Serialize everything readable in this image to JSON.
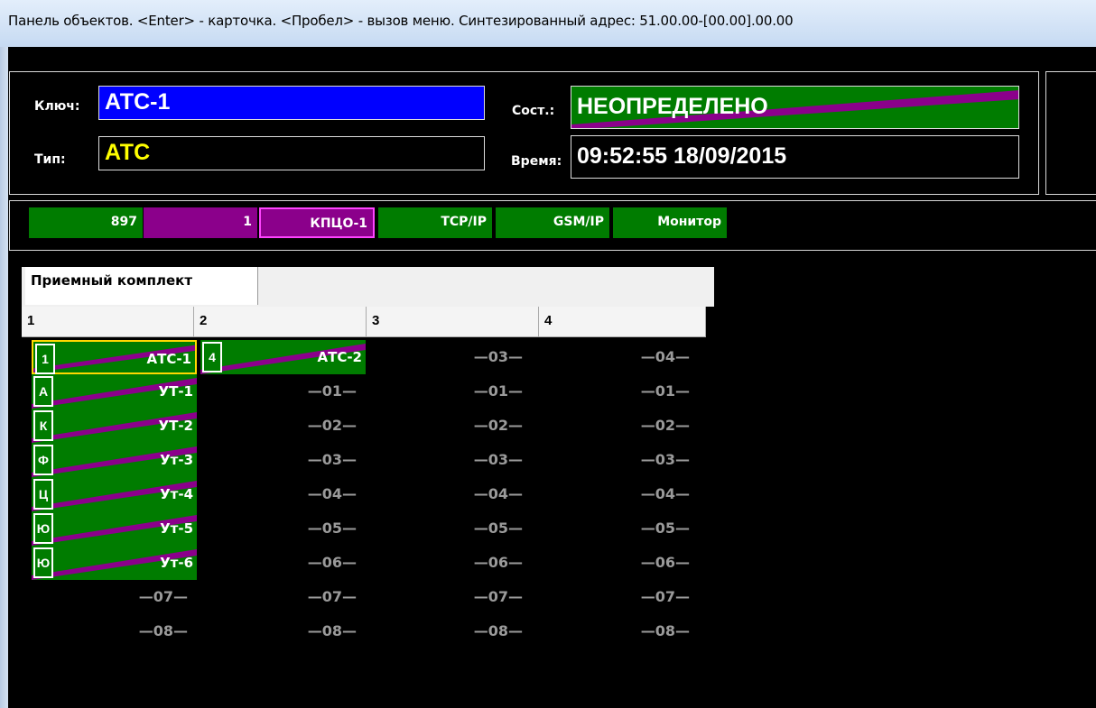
{
  "window": {
    "title": "Панель объектов. <Enter> - карточка. <Пробел> - вызов меню. Синтезированный адрес: 51.00.00-[00.00].00.00"
  },
  "header": {
    "key_label": "Ключ:",
    "key_value": "АТС-1",
    "type_label": "Тип:",
    "type_value": "АТС",
    "state_label": "Сост.:",
    "state_value": "НЕОПРЕДЕЛЕНО",
    "time_label": "Время:",
    "time_value": "09:52:55 18/09/2015"
  },
  "tags": [
    "897",
    "1",
    "КПЦО-1",
    "TCP/IP",
    "GSM/IP",
    "Монитор"
  ],
  "panel": {
    "tab": "Приемный комплект",
    "columns": [
      "1",
      "2",
      "3",
      "4"
    ],
    "rows": [
      [
        {
          "code": "1",
          "name": "АТС-1"
        },
        {
          "code": "4",
          "name": "АТС-2"
        },
        {
          "empty": "—03—"
        },
        {
          "empty": "—04—"
        }
      ],
      [
        {
          "code": "А",
          "name": "УТ-1"
        },
        {
          "empty": "—01—"
        },
        {
          "empty": "—01—"
        },
        {
          "empty": "—01—"
        }
      ],
      [
        {
          "code": "К",
          "name": "УТ-2"
        },
        {
          "empty": "—02—"
        },
        {
          "empty": "—02—"
        },
        {
          "empty": "—02—"
        }
      ],
      [
        {
          "code": "Ф",
          "name": "Ут-3"
        },
        {
          "empty": "—03—"
        },
        {
          "empty": "—03—"
        },
        {
          "empty": "—03—"
        }
      ],
      [
        {
          "code": "Ц",
          "name": "Ут-4"
        },
        {
          "empty": "—04—"
        },
        {
          "empty": "—04—"
        },
        {
          "empty": "—04—"
        }
      ],
      [
        {
          "code": "Ю",
          "name": "Ут-5"
        },
        {
          "empty": "—05—"
        },
        {
          "empty": "—05—"
        },
        {
          "empty": "—05—"
        }
      ],
      [
        {
          "code": "Ю",
          "name": "Ут-6"
        },
        {
          "empty": "—06—"
        },
        {
          "empty": "—06—"
        },
        {
          "empty": "—06—"
        }
      ],
      [
        {
          "empty": "—07—"
        },
        {
          "empty": "—07—"
        },
        {
          "empty": "—07—"
        },
        {
          "empty": "—07—"
        }
      ],
      [
        {
          "empty": "—08—"
        },
        {
          "empty": "—08—"
        },
        {
          "empty": "—08—"
        },
        {
          "empty": "—08—"
        }
      ]
    ]
  },
  "colors": {
    "green": "#007c00",
    "purple": "#8b008b",
    "blue": "#0000ff",
    "yellow": "#ffff00",
    "grey_text": "#9a9a9a"
  }
}
